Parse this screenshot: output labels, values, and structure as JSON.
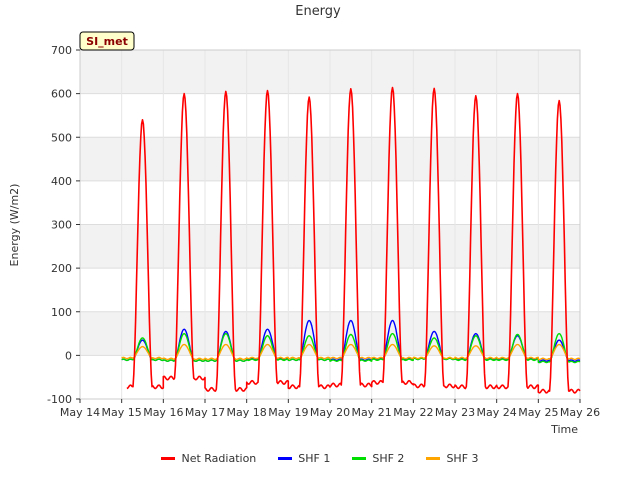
{
  "chart_data": {
    "type": "line",
    "title": "Energy",
    "xlabel": "Time",
    "ylabel": "Energy (W/m2)",
    "badge": "SI_met",
    "ylim": [
      -100,
      700
    ],
    "xlim": [
      "2024-05-14",
      "2024-05-26"
    ],
    "x_ticks": [
      "May 14",
      "May 15",
      "May 16",
      "May 17",
      "May 18",
      "May 19",
      "May 20",
      "May 21",
      "May 22",
      "May 23",
      "May 24",
      "May 25",
      "May 26"
    ],
    "y_ticks": [
      -100,
      0,
      100,
      200,
      300,
      400,
      500,
      600,
      700
    ],
    "grid": true,
    "legend_position": "bottom",
    "series": [
      {
        "name": "Net Radiation",
        "color": "#ff0000",
        "daily_peaks": [
          540,
          600,
          605,
          607,
          592,
          611,
          614,
          612,
          595,
          600,
          584
        ],
        "night_min": [
          -72,
          -52,
          -78,
          -62,
          -72,
          -68,
          -62,
          -70,
          -72,
          -72,
          -82
        ]
      },
      {
        "name": "SHF 1",
        "color": "#0000ff",
        "daily_peaks": [
          35,
          60,
          55,
          60,
          80,
          80,
          80,
          55,
          50,
          45,
          35
        ],
        "night_min": [
          -10,
          -12,
          -12,
          -8,
          -10,
          -10,
          -8,
          -8,
          -8,
          -8,
          -12
        ]
      },
      {
        "name": "SHF 2",
        "color": "#00dd00",
        "daily_peaks": [
          40,
          50,
          50,
          45,
          45,
          48,
          50,
          40,
          45,
          48,
          50
        ],
        "night_min": [
          -10,
          -12,
          -12,
          -10,
          -10,
          -12,
          -10,
          -8,
          -10,
          -10,
          -15
        ]
      },
      {
        "name": "SHF 3",
        "color": "#ffa500",
        "daily_peaks": [
          20,
          25,
          25,
          25,
          25,
          25,
          25,
          22,
          22,
          25,
          25
        ],
        "night_min": [
          -6,
          -8,
          -8,
          -6,
          -6,
          -6,
          -6,
          -6,
          -6,
          -6,
          -8
        ]
      }
    ]
  }
}
